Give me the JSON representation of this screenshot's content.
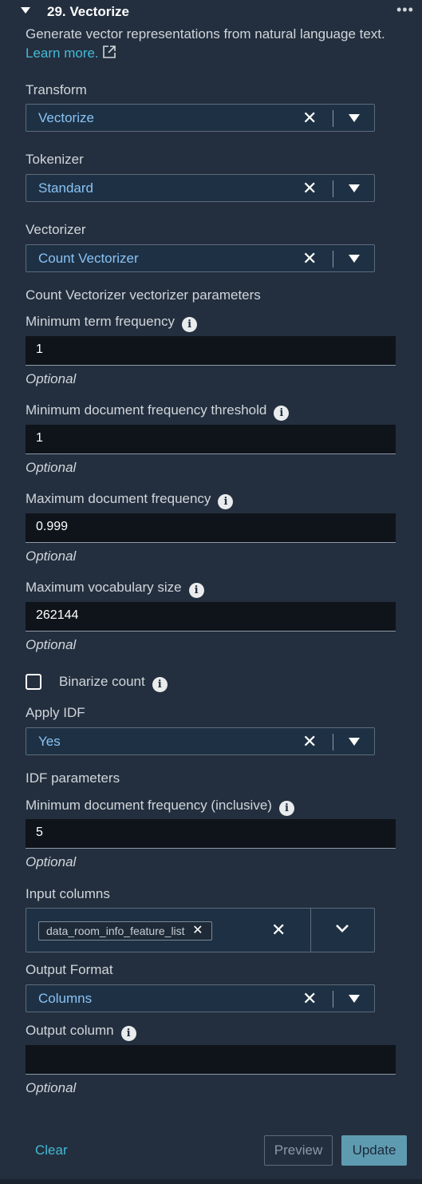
{
  "header": {
    "title": "29. Vectorize",
    "more_icon": "ellipsis-icon",
    "more_glyph": "•••"
  },
  "description": {
    "text": "Generate vector representations from natural language text.",
    "link": "Learn more."
  },
  "glyphs": {
    "clear": "✕",
    "info": "i",
    "token_remove": "✕"
  },
  "fields": {
    "transform": {
      "label": "Transform",
      "value": "Vectorize"
    },
    "tokenizer": {
      "label": "Tokenizer",
      "value": "Standard"
    },
    "vectorizer": {
      "label": "Vectorizer",
      "value": "Count Vectorizer"
    },
    "params_heading": "Count Vectorizer vectorizer parameters",
    "min_term_freq": {
      "label": "Minimum term frequency",
      "value": "1",
      "hint": "Optional"
    },
    "min_doc_freq": {
      "label": "Minimum document frequency threshold",
      "value": "1",
      "hint": "Optional"
    },
    "max_doc_freq": {
      "label": "Maximum document frequency",
      "value": "0.999",
      "hint": "Optional"
    },
    "max_vocab": {
      "label": "Maximum vocabulary size",
      "value": "262144",
      "hint": "Optional"
    },
    "binarize": {
      "label": "Binarize count",
      "checked": false
    },
    "apply_idf": {
      "label": "Apply IDF",
      "value": "Yes"
    },
    "idf_heading": "IDF parameters",
    "idf_min_doc_freq": {
      "label": "Minimum document frequency (inclusive)",
      "value": "5",
      "hint": "Optional"
    },
    "input_columns": {
      "label": "Input columns",
      "tokens": [
        "data_room_info_feature_list"
      ]
    },
    "output_format": {
      "label": "Output Format",
      "value": "Columns"
    },
    "output_column": {
      "label": "Output column",
      "value": "",
      "hint": "Optional"
    }
  },
  "footer": {
    "clear": "Clear",
    "preview": "Preview",
    "update": "Update"
  },
  "colors": {
    "accent": "#44b9d6",
    "select_value": "#89c2f5",
    "update_bg": "#5f9bb0"
  }
}
